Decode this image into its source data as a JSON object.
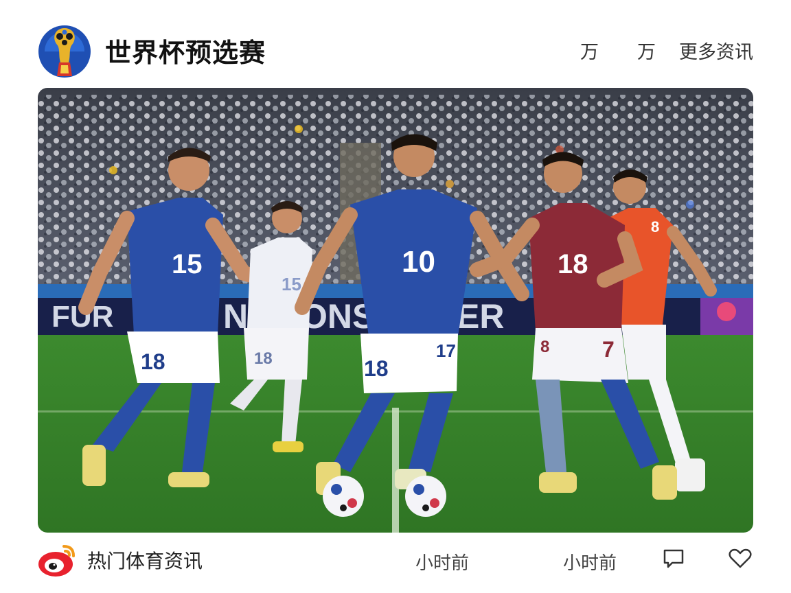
{
  "header": {
    "title": "世界杯预选赛",
    "stat_1": "万",
    "stat_2": "万",
    "more_link": "更多资讯",
    "logo_icon": "world-cup-trophy-icon"
  },
  "hero": {
    "icon": "football-match-photo",
    "ad_board_text": "FUR  NATION  ER",
    "players": [
      {
        "jersey": "15",
        "shorts": "18",
        "kit": "blue"
      },
      {
        "jersey": "15",
        "shorts": "18",
        "kit": "white"
      },
      {
        "jersey": "10",
        "shorts": "18",
        "kit": "blue"
      },
      {
        "jersey": "18",
        "shorts": "7",
        "kit": "maroon"
      },
      {
        "jersey": "8",
        "shorts": "",
        "kit": "orange"
      }
    ]
  },
  "footer": {
    "source_name": "热门体育资讯",
    "source_icon": "weibo-icon",
    "time_1": "小时前",
    "time_2": "小时前",
    "comment_icon": "comment-icon",
    "like_icon": "heart-icon"
  },
  "colors": {
    "blue_kit": "#2a4fa8",
    "maroon_kit": "#8c2a37",
    "orange_kit": "#e8542a",
    "pitch": "#3f8f2c",
    "text": "#333333"
  }
}
